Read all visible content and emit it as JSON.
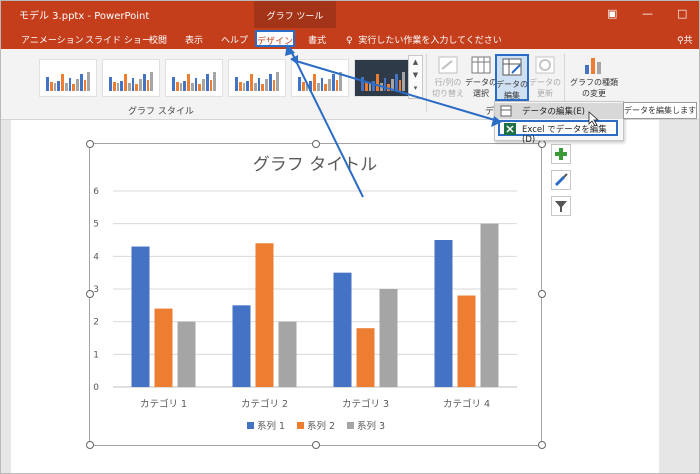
{
  "window": {
    "title": "モデル 3.pptx - PowerPoint",
    "context_tab": "グラフ ツール",
    "share_label": "共"
  },
  "tabs": [
    "アニメーション",
    "スライド ショー",
    "校閲",
    "表示",
    "ヘルプ"
  ],
  "active_tab": "デザイン",
  "format_tab": "書式",
  "tellme_placeholder": "実行したい作業を入力してください",
  "ribbon": {
    "styles_group_label": "グラフ スタイル",
    "data_group_label": "デー",
    "buttons": {
      "switch_row_col": "行/列の\n切り替え",
      "select_data": "データの\n選択",
      "edit_data": "データの\n編集",
      "refresh_data": "データの\n更新",
      "change_chart_type": "グラフの種類\nの変更"
    }
  },
  "dropdown": {
    "item_edit": "データの編集(E)",
    "item_excel": "Excel でデータを編集(D)"
  },
  "tooltip": "データを編集します",
  "side_buttons": [
    "chart-elements",
    "chart-styles",
    "chart-filters"
  ],
  "colors": {
    "accent": "#c43e1c",
    "highlight": "#2b6cc4",
    "series1": "#4472c4",
    "series2": "#ed7d31",
    "series3": "#a5a5a5"
  },
  "chart_data": {
    "type": "bar",
    "title": "グラフ タイトル",
    "categories": [
      "カテゴリ 1",
      "カテゴリ 2",
      "カテゴリ 3",
      "カテゴリ 4"
    ],
    "series": [
      {
        "name": "系列 1",
        "values": [
          4.3,
          2.5,
          3.5,
          4.5
        ]
      },
      {
        "name": "系列 2",
        "values": [
          2.4,
          4.4,
          1.8,
          2.8
        ]
      },
      {
        "name": "系列 3",
        "values": [
          2.0,
          2.0,
          3.0,
          5.0
        ]
      }
    ],
    "ylim": [
      0,
      6
    ],
    "yticks": [
      0,
      1,
      2,
      3,
      4,
      5,
      6
    ],
    "grid": true,
    "legend_position": "bottom"
  }
}
